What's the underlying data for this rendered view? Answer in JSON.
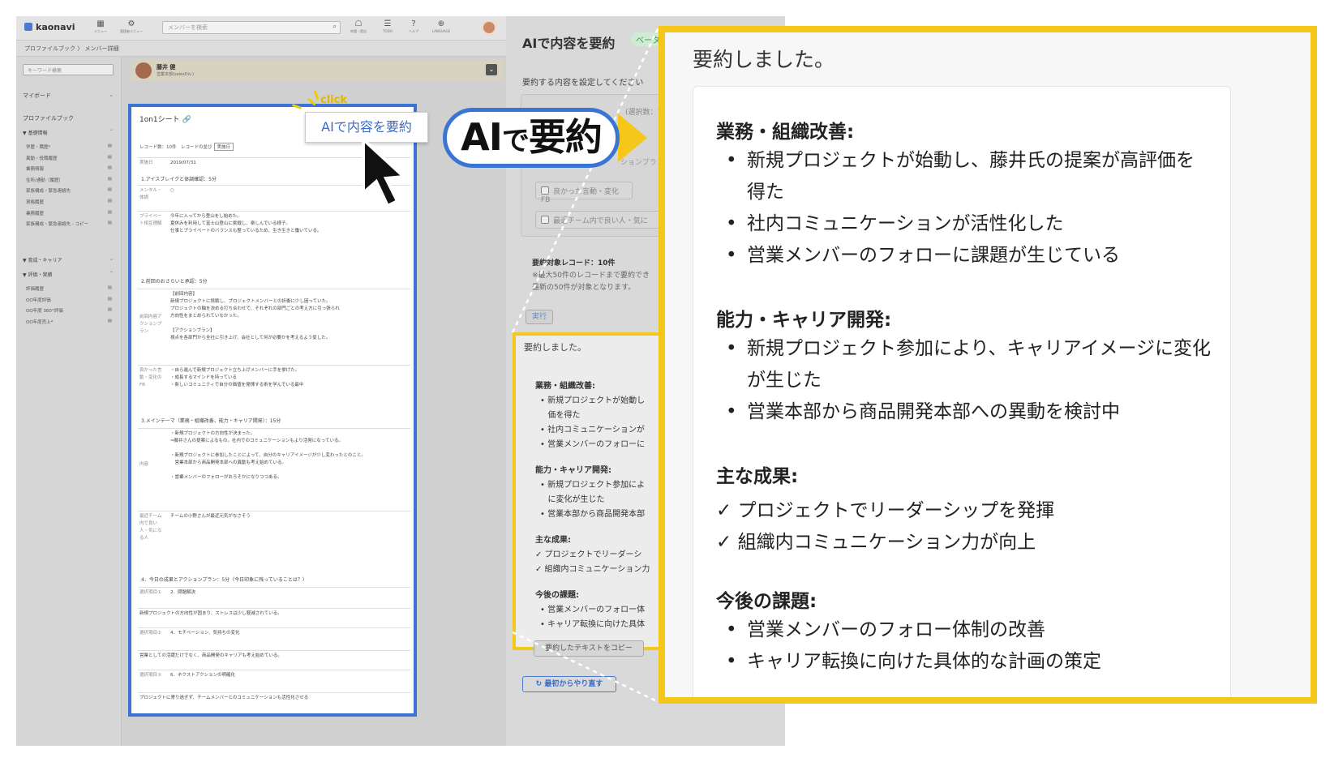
{
  "app": {
    "logo": "kaonavi",
    "topbar": {
      "menu": {
        "icon": "grid-icon",
        "label": "メニュー"
      },
      "admin": {
        "icon": "gear-icon",
        "label": "管理者メニュー"
      },
      "search_placeholder": "メンバーを検索",
      "apply": {
        "label": "申請・提出"
      },
      "todo": {
        "label": "TODO"
      },
      "help": {
        "label": "ヘルプ"
      },
      "language": {
        "label": "LANGUAGE"
      }
    },
    "breadcrumb": "プロファイルブック 〉 メンバー詳細",
    "sidebar": {
      "keyword_placeholder": "キーワード検索",
      "mypage": "マイボード",
      "profilebook": "プロファイルブック",
      "basic_section": "▼ 基礎情報",
      "basic_items": [
        "学歴・職歴*",
        "異動・役職履歴",
        "業務情報",
        "住所/通勤（履歴）",
        "家族構成・緊急連絡先",
        "資格履歴",
        "業務履歴",
        "家族構成・緊急連絡先 - コピー"
      ],
      "career_section": "▼ 育成・キャリア",
      "eval_section": "▼ 評価・実績",
      "eval_items": [
        "評価履歴",
        "OO年度評価",
        "OO年度 360°評価",
        "OO年度売上*"
      ]
    },
    "profile": {
      "name": "藤井 健",
      "dept": "営業本部(salesDiv.)"
    },
    "sheet": {
      "title": "1on1シート",
      "record_info": "レコード数：10件　レコードの並び",
      "sort_value": "実施日",
      "date_label": "実施日",
      "date_value": "2019/07/31",
      "sec1": "1.アイスブレイクと体調確認：5分",
      "mental_label": "メンタル・体調",
      "mental_value": "○",
      "private_label": "プライベート相互理解",
      "private_value": "今年に入ってから登山をし始めた。\n夏休みを利用して富士山登山に挑戦し、楽しんでいる様子。\n仕事とプライベートのバランスも整っているため、生き生きと働いている。",
      "sec2": "2.前回のおさらいと承認：5分",
      "prev_label": "前回内容アクションプラン",
      "prev_value": "【前回内容】\n新規プロジェクトに挑戦し、プロジェクトメンバーとの折衝に少し困っていた。\nプロジェクトの軸を決める打ち合わせで、それぞれの部門ごとの考え方に引っ張られ\n方向性をまとめられていなかった。\n\n【アクションプラン】\n視点を各部門から全社に引き上げ、会社として何が必要かを考えるよう促した。",
      "good_label": "良かった言動・変化のFB",
      "good_value": "・自ら進んで新規プロジェクト立ち上げメンバーに手を挙げた。\n・成長するマインドを持っている\n・新しいコミュニティで自分の価値を発揮する術を学んでいる最中",
      "sec3": "3.メインテーマ（業務・組織改善、能力・キャリア開発）：15分",
      "content_label": "内容",
      "content_value": "・新規プロジェクトの方向性が決まった。\n⇒藤井さんの提案によるもの。社内でのコミュニケーションもより活発になっている。\n\n・新規プロジェクトに参加したことによって、自分のキャリアイメージが少し変わったとのこと。\n　営業本部から商品開発本部への異動も考え始めている。\n\n・営業メンバーのフォローがおろそかになりつつある。",
      "team_label": "最近チーム内で良い人・気になる人",
      "team_value": "チームの小野さんが最近元気がなさそう",
      "sec4": "4．今日の成果とアクションプラン：5分（今日印象に残っていることは？）",
      "choice1_label": "選択項目①",
      "choice1_value": "2．問題解決",
      "choice1_note": "新規プロジェクトの方向性が固まり、ストレスは少し軽減されている。",
      "choice2_label": "選択項目②",
      "choice2_value": "4．モチベーション、気持ちの変化",
      "choice2_note": "営業としての活躍だけでなく、商品開発のキャリアも考え始めている。",
      "choice3_label": "選択項目③",
      "choice3_value": "6．ネクストアクションの明確化",
      "choice3_note": "プロジェクトに寄り過ぎず、チームメンバーとのコミュニケーションも活性化させる"
    },
    "callout": {
      "click": "click",
      "button": "AIで内容を要約"
    }
  },
  "badge": {
    "ai": "AI",
    "de": "で",
    "youyaku": "要約"
  },
  "panel": {
    "title": "AIで内容を要約",
    "beta": "ベータ",
    "subtitle": "要約する内容を設定してください",
    "count_hint": "(選択数：1 / 10)",
    "action_plan_hint": "ションプラン",
    "checks": [
      "良かった言動・変化FB",
      "最近チーム内で良い人・気に"
    ],
    "record_heading": "要約対象レコード：10件",
    "record_note": "※最大50件のレコードまで要約でき\n最新の50件が対象となります。",
    "run": "実行",
    "copy": "要約したテキストをコピー",
    "retry": "最初からやり直す"
  },
  "summary": {
    "done": "要約しました。",
    "sections": [
      {
        "heading": "業務・組織改善:",
        "bullets": [
          "新規プロジェクトが始動し、藤井氏の提案が高評価を得た",
          "社内コミュニケーションが活性化した",
          "営業メンバーのフォローに課題が生じている"
        ]
      },
      {
        "heading": "能力・キャリア開発:",
        "bullets": [
          "新規プロジェクト参加により、キャリアイメージに変化が生じた",
          "営業本部から商品開発本部への異動を検討中"
        ]
      },
      {
        "heading": "主な成果:",
        "checks": [
          "✓ プロジェクトでリーダーシップを発揮",
          "✓ 組織内コミュニケーション力が向上"
        ]
      },
      {
        "heading": "今後の課題:",
        "bullets": [
          "営業メンバーのフォロー体制の改善",
          "キャリア転換に向けた具体的な計画の策定"
        ]
      }
    ],
    "mini": {
      "s1": "業務・組織改善:",
      "s1_items": [
        "新規プロジェクトが始動し",
        "価を得た",
        "社内コミュニケーションが",
        "営業メンバーのフォローに"
      ],
      "s2": "能力・キャリア開発:",
      "s2_items": [
        "新規プロジェクト参加によ",
        "に変化が生じた",
        "営業本部から商品開発本部"
      ],
      "s3": "主な成果:",
      "s3_items": [
        "✓ プロジェクトでリーダーシ",
        "✓ 組織内コミュニケーション力"
      ],
      "s4": "今後の課題:",
      "s4_items": [
        "営業メンバーのフォロー体",
        "キャリア転換に向けた具体"
      ]
    }
  },
  "colors": {
    "accent_blue": "#3a75d6",
    "highlight_yellow": "#f4c71a"
  }
}
